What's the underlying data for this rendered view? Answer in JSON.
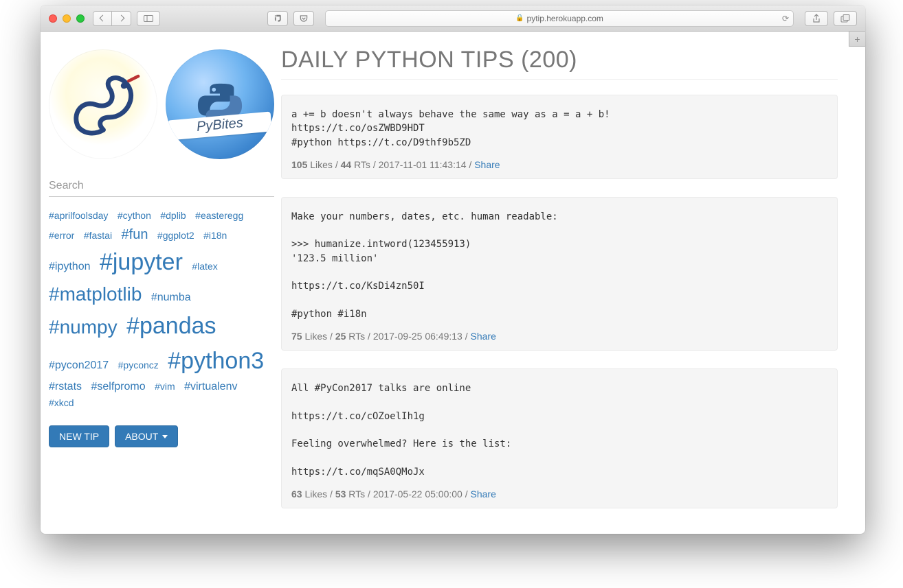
{
  "browser": {
    "url_host": "pytip.herokuapp.com"
  },
  "sidebar": {
    "search_placeholder": "Search",
    "tags": [
      {
        "label": "#aprilfoolsday",
        "size": 1
      },
      {
        "label": "#cython",
        "size": 1
      },
      {
        "label": "#dplib",
        "size": 1
      },
      {
        "label": "#easteregg",
        "size": 1
      },
      {
        "label": "#error",
        "size": 1
      },
      {
        "label": "#fastai",
        "size": 1
      },
      {
        "label": "#fun",
        "size": 3
      },
      {
        "label": "#ggplot2",
        "size": 1
      },
      {
        "label": "#i18n",
        "size": 1
      },
      {
        "label": "#ipython",
        "size": 2
      },
      {
        "label": "#jupyter",
        "size": 6
      },
      {
        "label": "#latex",
        "size": 1
      },
      {
        "label": "#matplotlib",
        "size": 5
      },
      {
        "label": "#numba",
        "size": 2
      },
      {
        "label": "#numpy",
        "size": 5
      },
      {
        "label": "#pandas",
        "size": 6
      },
      {
        "label": "#pycon2017",
        "size": 2
      },
      {
        "label": "#pyconcz",
        "size": 1
      },
      {
        "label": "#python3",
        "size": 6
      },
      {
        "label": "#rstats",
        "size": 2
      },
      {
        "label": "#selfpromo",
        "size": 2
      },
      {
        "label": "#vim",
        "size": 1
      },
      {
        "label": "#virtualenv",
        "size": 2
      },
      {
        "label": "#xkcd",
        "size": 1
      }
    ],
    "buttons": {
      "new_tip": "NEW TIP",
      "about": "ABOUT"
    },
    "pybites_label": "PyBites"
  },
  "main": {
    "title": "DAILY PYTHON TIPS (200)",
    "meta_labels": {
      "likes": "Likes",
      "rts": "RTs",
      "share": "Share",
      "sep": " / "
    },
    "tips": [
      {
        "text": "a += b doesn't always behave the same way as a = a + b!\nhttps://t.co/osZWBD9HDT\n#python https://t.co/D9thf9b5ZD",
        "likes": "105",
        "rts": "44",
        "date": "2017-11-01 11:43:14"
      },
      {
        "text": "Make your numbers, dates, etc. human readable:\n\n>>> humanize.intword(123455913)\n'123.5 million'\n\nhttps://t.co/KsDi4zn50I\n\n#python #i18n",
        "likes": "75",
        "rts": "25",
        "date": "2017-09-25 06:49:13"
      },
      {
        "text": "All #PyCon2017 talks are online\n\nhttps://t.co/cOZoelIh1g\n\nFeeling overwhelmed? Here is the list:\n\nhttps://t.co/mqSA0QMoJx",
        "likes": "63",
        "rts": "53",
        "date": "2017-05-22 05:00:00"
      }
    ]
  }
}
